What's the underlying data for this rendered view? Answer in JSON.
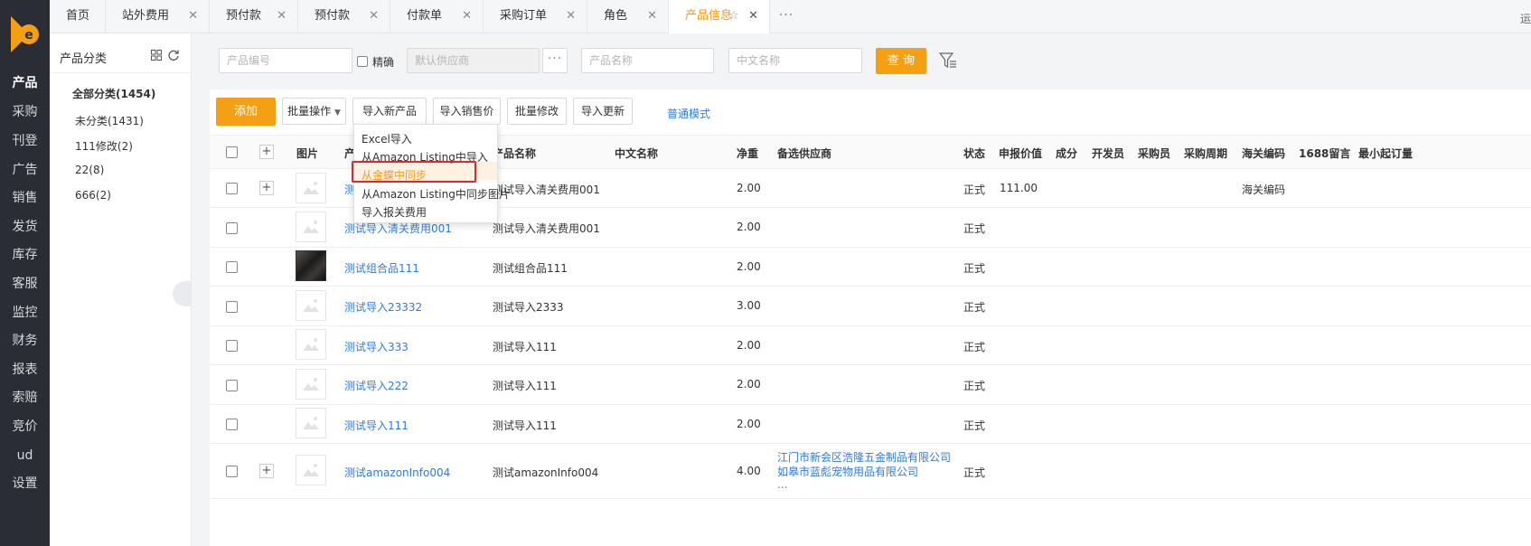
{
  "colors": {
    "accent": "#f5a014",
    "link": "#2f7bd9",
    "nav_bg": "#2a2d33",
    "highlight_box": "#e0262b"
  },
  "leftnav": {
    "items": [
      {
        "label": "产品",
        "active": true
      },
      {
        "label": "采购"
      },
      {
        "label": "刊登"
      },
      {
        "label": "广告"
      },
      {
        "label": "销售"
      },
      {
        "label": "发货"
      },
      {
        "label": "库存"
      },
      {
        "label": "客服"
      },
      {
        "label": "监控"
      },
      {
        "label": "财务"
      },
      {
        "label": "报表"
      },
      {
        "label": "索赔"
      },
      {
        "label": "竞价"
      },
      {
        "label": "ud"
      },
      {
        "label": "设置"
      }
    ]
  },
  "tabs": [
    {
      "label": "首页"
    },
    {
      "label": "站外费用"
    },
    {
      "label": "预付款"
    },
    {
      "label": "预付款"
    },
    {
      "label": "付款单"
    },
    {
      "label": "采购订单"
    },
    {
      "label": "角色"
    },
    {
      "label": "产品信息",
      "active": true
    }
  ],
  "tab_more": "···",
  "tab_edge_glyph": "运",
  "category": {
    "title": "产品分类",
    "items": [
      "全部分类(1454)",
      "未分类(1431)",
      "111修改(2)",
      "22(8)",
      "666(2)"
    ]
  },
  "filters": {
    "product_code_placeholder": "产品编号",
    "exact_label": "精确",
    "supplier_placeholder": "默认供应商",
    "more_glyph": "···",
    "product_name_placeholder": "产品名称",
    "chinese_name_placeholder": "中文名称",
    "query_label": "查 询"
  },
  "toolbar": {
    "add": "添加",
    "batch": "批量操作",
    "import_new": "导入新产品",
    "import_price": "导入销售价",
    "batch_modify": "批量修改",
    "import_update": "导入更新",
    "mode": "普通模式"
  },
  "dropdown": {
    "items": [
      "Excel导入",
      "从Amazon Listing中导入",
      "从金蝶中同步",
      "从Amazon Listing中同步图片",
      "导入报关费用"
    ]
  },
  "table": {
    "headers": {
      "image": "图片",
      "sku": "产",
      "name": "产品名称",
      "cn_name": "中文名称",
      "weight": "净重",
      "supplier": "备选供应商",
      "status": "状态",
      "declared": "申报价值",
      "cost": "成分",
      "developer": "开发员",
      "buyer": "采购员",
      "cycle": "采购周期",
      "hs_code": "海关编码",
      "note1688": "1688留言",
      "moq": "最小起订量"
    },
    "rows": [
      {
        "sku": "测",
        "name": "测试导入清关费用001",
        "weight": "2.00",
        "status": "正式",
        "declared": "111.00",
        "hs_code": "海关编码",
        "plus": true
      },
      {
        "sku": "测试导入清关费用001",
        "name": "测试导入清关费用001",
        "weight": "2.00",
        "status": "正式"
      },
      {
        "sku": "测试组合品111",
        "name": "测试组合品111",
        "weight": "2.00",
        "status": "正式",
        "photo": true
      },
      {
        "sku": "测试导入23332",
        "name": "测试导入2333",
        "weight": "3.00",
        "status": "正式"
      },
      {
        "sku": "测试导入333",
        "name": "测试导入111",
        "weight": "2.00",
        "status": "正式"
      },
      {
        "sku": "测试导入222",
        "name": "测试导入111",
        "weight": "2.00",
        "status": "正式"
      },
      {
        "sku": "测试导入111",
        "name": "测试导入111",
        "weight": "2.00",
        "status": "正式"
      },
      {
        "sku": "测试amazonInfo004",
        "name": "测试amazonInfo004",
        "weight": "4.00",
        "status": "正式",
        "plus": true,
        "suppliers": [
          "江门市新会区浩隆五金制品有限公司",
          "如皋市蓝彪宠物用品有限公司",
          "..."
        ]
      }
    ]
  }
}
